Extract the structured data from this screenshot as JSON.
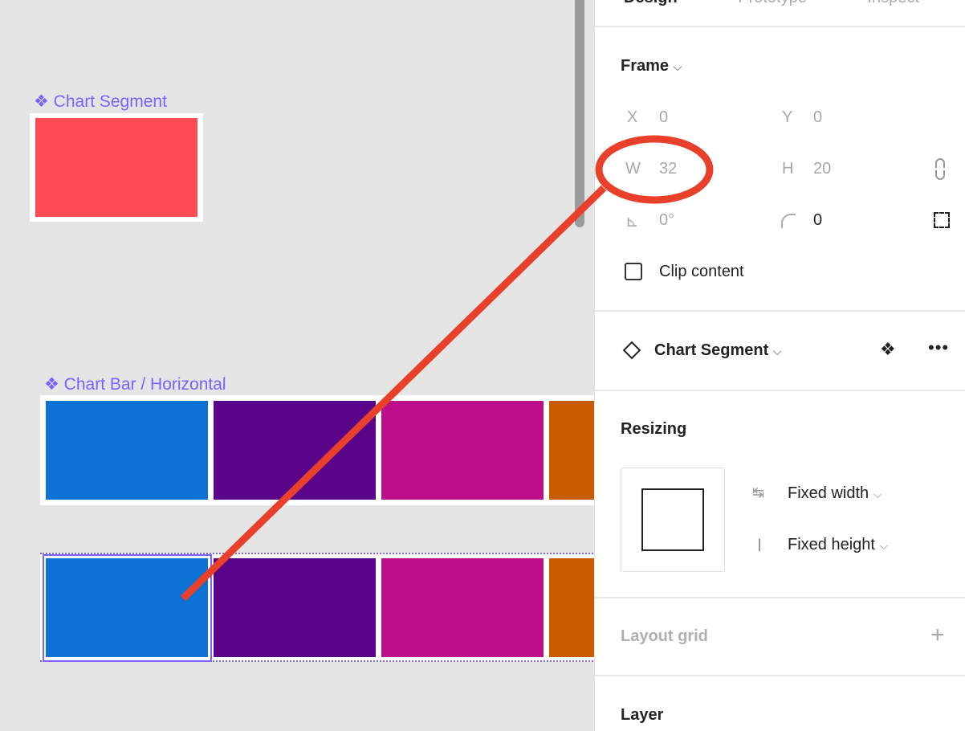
{
  "canvas": {
    "component_label": "Chart Segment",
    "bar_label": "Chart Bar / Horizontal",
    "colors": {
      "segment": "#ff4c55",
      "blue": "#0d72d5",
      "purple": "#5a0589",
      "magenta": "#bb0f8b",
      "orange": "#c95c00",
      "selection": "#7b61ff",
      "annotation": "#e8402a"
    }
  },
  "panel": {
    "tabs": [
      "Design",
      "Prototype",
      "Inspect"
    ],
    "frame": {
      "title": "Frame",
      "x_label": "X",
      "x": "0",
      "y_label": "Y",
      "y": "0",
      "w_label": "W",
      "w": "32",
      "h_label": "H",
      "h": "20",
      "rotation": "0°",
      "radius": "0",
      "clip_content": "Clip content"
    },
    "component": {
      "name": "Chart Segment"
    },
    "resizing": {
      "title": "Resizing",
      "width_mode": "Fixed width",
      "height_mode": "Fixed height"
    },
    "layout_grid": "Layout grid",
    "layer": "Layer"
  }
}
